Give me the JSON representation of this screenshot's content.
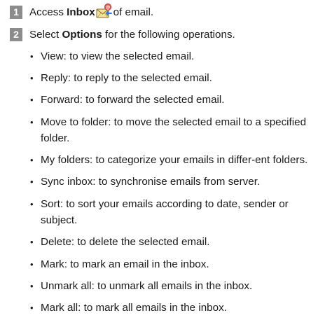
{
  "step1": {
    "number": "1",
    "text_before": "Access ",
    "bold": "Inbox",
    "text_after": "of email.",
    "icon": "inbox-mail-icon"
  },
  "step2": {
    "number": "2",
    "text_before": "Select ",
    "bold": "Options",
    "text_after": " for the following operations."
  },
  "options": [
    "View: to view the selected email.",
    "Reply: to reply to the selected email.",
    "Forward: to forward the selected email.",
    "Move to folder: to move the selected email to a specified folder.",
    "My folders: to categorize your emails in differ-ent folders.",
    "Sync inbox: to synchronise emails from server.",
    "Sort: to sort your emails according to date, sender or subject.",
    "Delete: to delete the selected email.",
    "Mark: to mark an email in the inbox.",
    "Unmark all: to unmark all emails in the inbox.",
    "Mark all: to mark all emails in the inbox."
  ]
}
